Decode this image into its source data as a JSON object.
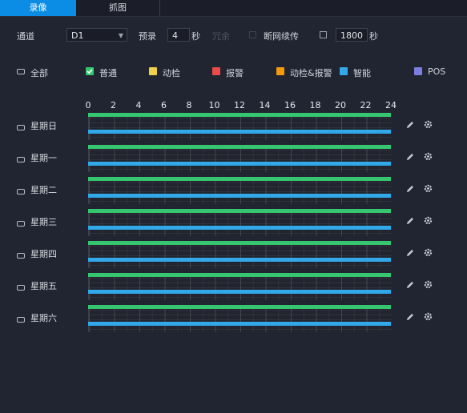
{
  "tabs": {
    "record": "录像",
    "snapshot": "抓图"
  },
  "options": {
    "channel_label": "通道",
    "channel_value": "D1",
    "prerecord_label": "预录",
    "prerecord_value": "4",
    "prerecord_unit": "秒",
    "redundancy_label": "冗余",
    "anr_label": "断网续传",
    "anr_value": "1800",
    "anr_unit": "秒"
  },
  "legend": {
    "all": "全部",
    "items": [
      {
        "label": "普通",
        "color": "#35c66f",
        "checked": true
      },
      {
        "label": "动检",
        "color": "#f0d04a",
        "checked": false
      },
      {
        "label": "报警",
        "color": "#ea4a4a",
        "checked": false
      },
      {
        "label": "动检&报警",
        "color": "#f2990c",
        "checked": false
      },
      {
        "label": "智能",
        "color": "#32a8e8",
        "checked": false
      },
      {
        "label": "POS",
        "color": "#7a7ee0",
        "checked": false
      }
    ]
  },
  "axis_hours": [
    "0",
    "2",
    "4",
    "6",
    "8",
    "10",
    "12",
    "14",
    "16",
    "18",
    "20",
    "22",
    "24"
  ],
  "days": [
    {
      "label": "星期日",
      "normal": [
        0,
        24
      ],
      "smart": [
        0,
        24
      ]
    },
    {
      "label": "星期一",
      "normal": [
        0,
        24
      ],
      "smart": [
        0,
        24
      ]
    },
    {
      "label": "星期二",
      "normal": [
        0,
        24
      ],
      "smart": [
        0,
        24
      ]
    },
    {
      "label": "星期三",
      "normal": [
        0,
        24
      ],
      "smart": [
        0,
        24
      ]
    },
    {
      "label": "星期四",
      "normal": [
        0,
        24
      ],
      "smart": [
        0,
        24
      ]
    },
    {
      "label": "星期五",
      "normal": [
        0,
        24
      ],
      "smart": [
        0,
        24
      ]
    },
    {
      "label": "星期六",
      "normal": [
        0,
        24
      ],
      "smart": [
        0,
        24
      ]
    }
  ]
}
